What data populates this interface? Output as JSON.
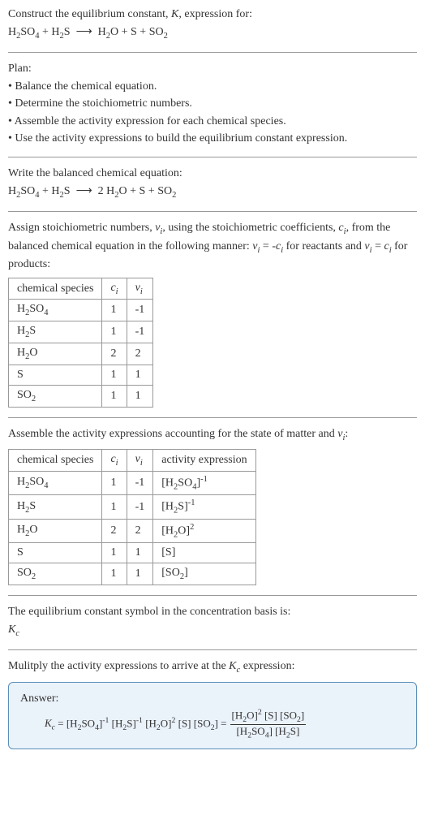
{
  "header": {
    "prompt": "Construct the equilibrium constant, K, expression for:",
    "equation": "H₂SO₄ + H₂S ⟶ H₂O + S + SO₂"
  },
  "plan": {
    "title": "Plan:",
    "items": [
      "• Balance the chemical equation.",
      "• Determine the stoichiometric numbers.",
      "• Assemble the activity expression for each chemical species.",
      "• Use the activity expressions to build the equilibrium constant expression."
    ]
  },
  "balanced": {
    "title": "Write the balanced chemical equation:",
    "equation": "H₂SO₄ + H₂S ⟶ 2 H₂O + S + SO₂"
  },
  "assign": {
    "text": "Assign stoichiometric numbers, νᵢ, using the stoichiometric coefficients, cᵢ, from the balanced chemical equation in the following manner: νᵢ = -cᵢ for reactants and νᵢ = cᵢ for products:",
    "table": {
      "headers": [
        "chemical species",
        "cᵢ",
        "νᵢ"
      ],
      "rows": [
        [
          "H₂SO₄",
          "1",
          "-1"
        ],
        [
          "H₂S",
          "1",
          "-1"
        ],
        [
          "H₂O",
          "2",
          "2"
        ],
        [
          "S",
          "1",
          "1"
        ],
        [
          "SO₂",
          "1",
          "1"
        ]
      ]
    }
  },
  "activity": {
    "text": "Assemble the activity expressions accounting for the state of matter and νᵢ:",
    "table": {
      "headers": [
        "chemical species",
        "cᵢ",
        "νᵢ",
        "activity expression"
      ],
      "rows": [
        {
          "species": "H₂SO₄",
          "c": "1",
          "v": "-1",
          "expr": "[H₂SO₄]⁻¹"
        },
        {
          "species": "H₂S",
          "c": "1",
          "v": "-1",
          "expr": "[H₂S]⁻¹"
        },
        {
          "species": "H₂O",
          "c": "2",
          "v": "2",
          "expr": "[H₂O]²"
        },
        {
          "species": "S",
          "c": "1",
          "v": "1",
          "expr": "[S]"
        },
        {
          "species": "SO₂",
          "c": "1",
          "v": "1",
          "expr": "[SO₂]"
        }
      ]
    }
  },
  "symbol": {
    "text": "The equilibrium constant symbol in the concentration basis is:",
    "value": "K_c"
  },
  "multiply": {
    "text": "Mulitply the activity expressions to arrive at the K_c expression:"
  },
  "answer": {
    "label": "Answer:",
    "lhs": "K_c = [H₂SO₄]⁻¹ [H₂S]⁻¹ [H₂O]² [S] [SO₂] =",
    "frac_num": "[H₂O]² [S] [SO₂]",
    "frac_den": "[H₂SO₄] [H₂S]"
  }
}
